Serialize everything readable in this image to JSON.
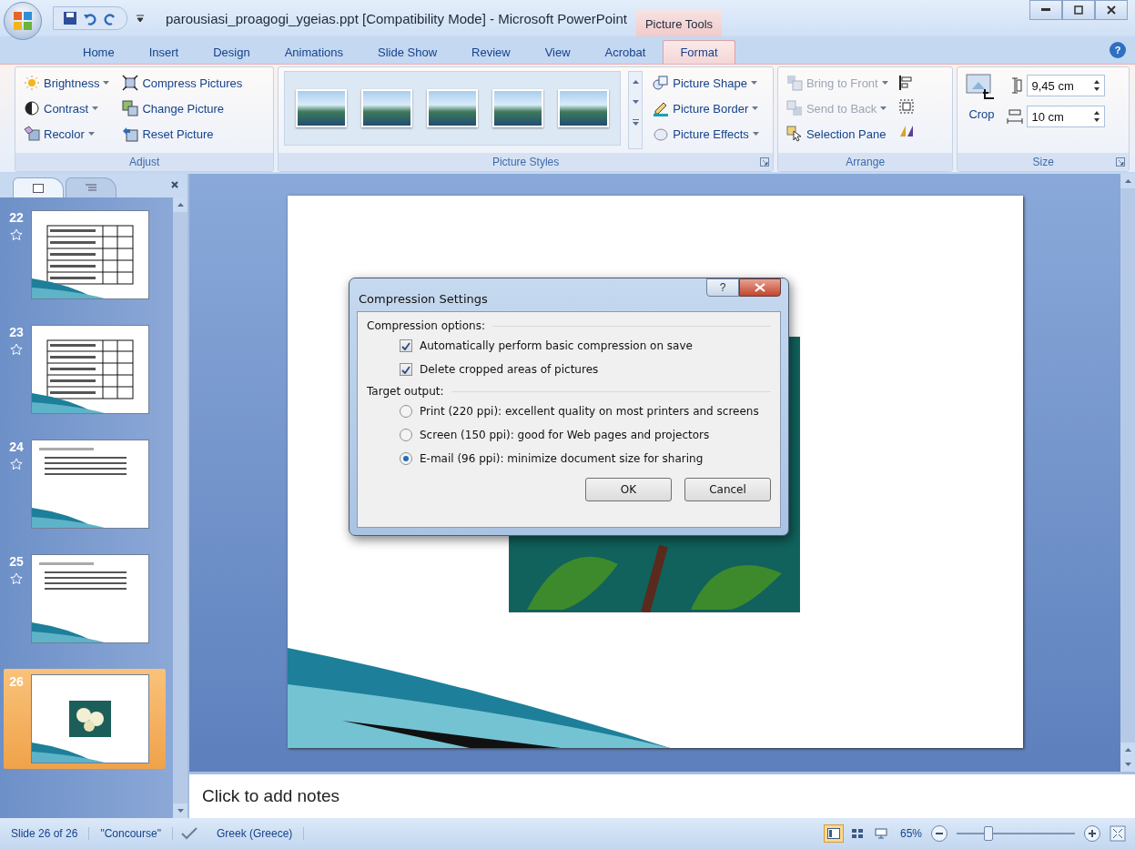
{
  "window": {
    "title": "parousiasi_proagogi_ygeias.ppt [Compatibility Mode] - Microsoft PowerPoint",
    "context_tab": "Picture Tools"
  },
  "ribbon_tabs": [
    {
      "label": "Home",
      "selected": false
    },
    {
      "label": "Insert",
      "selected": false
    },
    {
      "label": "Design",
      "selected": false
    },
    {
      "label": "Animations",
      "selected": false
    },
    {
      "label": "Slide Show",
      "selected": false
    },
    {
      "label": "Review",
      "selected": false
    },
    {
      "label": "View",
      "selected": false
    },
    {
      "label": "Acrobat",
      "selected": false
    },
    {
      "label": "Format",
      "selected": true
    }
  ],
  "help_button": "?",
  "ribbon": {
    "adjust": {
      "label": "Adjust",
      "commands": [
        {
          "label": "Brightness",
          "kind": "brightness",
          "dropdown": true
        },
        {
          "label": "Compress Pictures",
          "kind": "compress",
          "dropdown": false
        },
        {
          "label": "Contrast",
          "kind": "contrast",
          "dropdown": true
        },
        {
          "label": "Change Picture",
          "kind": "change",
          "dropdown": false
        },
        {
          "label": "Recolor",
          "kind": "recolor",
          "dropdown": true
        },
        {
          "label": "Reset Picture",
          "kind": "reset",
          "dropdown": false
        }
      ]
    },
    "picture_styles": {
      "label": "Picture Styles",
      "commands": [
        {
          "label": "Picture Shape",
          "kind": "shape"
        },
        {
          "label": "Picture Border",
          "kind": "border"
        },
        {
          "label": "Picture Effects",
          "kind": "effects"
        }
      ]
    },
    "arrange": {
      "label": "Arrange",
      "commands": [
        {
          "label": "Bring to Front",
          "kind": "front",
          "disabled": true,
          "dropdown": true
        },
        {
          "label": "Send to Back",
          "kind": "back",
          "disabled": true,
          "dropdown": true
        },
        {
          "label": "Selection Pane",
          "kind": "selection",
          "disabled": false,
          "dropdown": false
        }
      ]
    },
    "size": {
      "label": "Size",
      "crop": "Crop",
      "height": "9,45 cm",
      "width": "10 cm"
    }
  },
  "slides": [
    {
      "number": "22",
      "kind": "table",
      "selected": false,
      "animated": true
    },
    {
      "number": "23",
      "kind": "table",
      "selected": false,
      "animated": true
    },
    {
      "number": "24",
      "kind": "bullets",
      "selected": false,
      "animated": true
    },
    {
      "number": "25",
      "kind": "bullets",
      "selected": false,
      "animated": true
    },
    {
      "number": "26",
      "kind": "picture",
      "selected": true,
      "animated": false
    }
  ],
  "notes": {
    "placeholder": "Click to add notes"
  },
  "dialog": {
    "title": "Compression Settings",
    "options_label": "Compression options:",
    "options": [
      {
        "label": "Automatically perform basic compression on save",
        "checked": true
      },
      {
        "label": "Delete cropped areas of pictures",
        "checked": true
      }
    ],
    "target_label": "Target output:",
    "targets": [
      {
        "label": "Print (220 ppi): excellent quality on most printers and screens",
        "selected": false
      },
      {
        "label": "Screen (150 ppi): good for Web pages and projectors",
        "selected": false
      },
      {
        "label": "E-mail (96 ppi): minimize document size for sharing",
        "selected": true
      }
    ],
    "help_button": "?",
    "buttons": [
      "OK",
      "Cancel"
    ]
  },
  "status_bar": {
    "slide": "Slide 26 of 26",
    "theme": "\"Concourse\"",
    "language": "Greek (Greece)",
    "zoom": "65%",
    "zoom_slider": {
      "level": 0.27
    },
    "views": [
      {
        "kind": "normal",
        "selected": true
      },
      {
        "kind": "sorter",
        "selected": false
      },
      {
        "kind": "show",
        "selected": false
      }
    ]
  }
}
